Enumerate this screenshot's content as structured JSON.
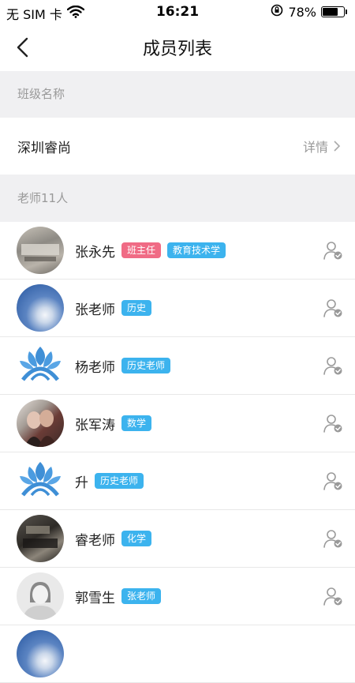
{
  "status_bar": {
    "carrier": "无 SIM 卡",
    "time": "16:21",
    "battery": "78%",
    "battery_level": 0.78
  },
  "nav": {
    "title": "成员列表"
  },
  "sections": {
    "class_header": "班级名称",
    "teachers_header": "老师11人"
  },
  "class_info": {
    "name": "深圳睿尚",
    "details_label": "详情"
  },
  "members": [
    {
      "name": "张永先",
      "tags": [
        "班主任",
        "教育技术学"
      ]
    },
    {
      "name": "张老师",
      "tags": [
        "历史"
      ]
    },
    {
      "name": "杨老师",
      "tags": [
        "历史老师"
      ]
    },
    {
      "name": "张军涛",
      "tags": [
        "数学"
      ]
    },
    {
      "name": "升",
      "tags": [
        "历史老师"
      ]
    },
    {
      "name": "睿老师",
      "tags": [
        "化学"
      ]
    },
    {
      "name": "郭雪生",
      "tags": [
        "张老师"
      ]
    }
  ],
  "colors": {
    "tag_pink": "#f06b85",
    "tag_blue": "#3cb3ee",
    "section_bg": "#f0f0f2"
  }
}
